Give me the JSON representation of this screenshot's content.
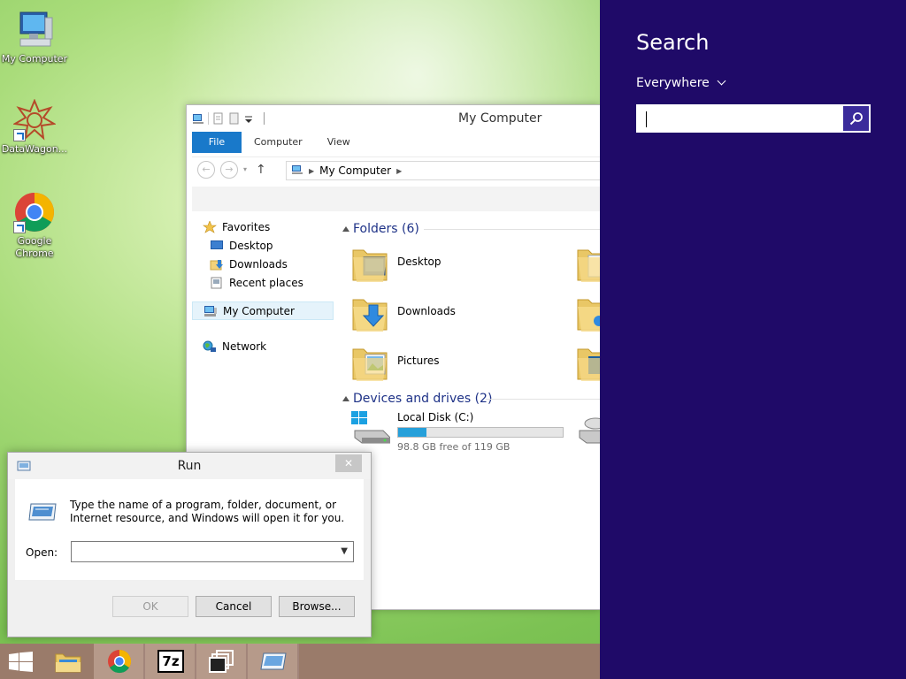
{
  "desktop": {
    "icons": [
      {
        "label": "My Computer"
      },
      {
        "label": "DataWagon..."
      },
      {
        "label": "Google Chrome"
      }
    ]
  },
  "explorer": {
    "title": "My Computer",
    "tabs": [
      "File",
      "Computer",
      "View"
    ],
    "address": "My Computer",
    "nav": {
      "favorites": "Favorites",
      "desktop": "Desktop",
      "downloads": "Downloads",
      "recent": "Recent places",
      "computer": "My Computer",
      "network": "Network"
    },
    "folders_header": "Folders (6)",
    "folders": [
      "Desktop",
      "Downloads",
      "Pictures"
    ],
    "drives_header": "Devices and drives (2)",
    "drive": {
      "name": "Local Disk (C:)",
      "free_text": "98.8 GB free of 119 GB",
      "used_fraction": 0.17
    }
  },
  "run": {
    "title": "Run",
    "close": "✕",
    "message": "Type the name of a program, folder, document, or Internet resource, and Windows will open it for you.",
    "open_label": "Open:",
    "open_value": "",
    "ok": "OK",
    "cancel": "Cancel",
    "browse": "Browse..."
  },
  "taskbar": {
    "items": [
      "start-icon",
      "file-explorer-icon",
      "chrome-icon",
      "7zip-icon",
      "task-view-icon",
      "run-icon"
    ],
    "sevenzip_text": "7z"
  },
  "charm": {
    "heading": "Search",
    "scope": "Everywhere",
    "query": "",
    "colors": {
      "background": "#1f0a68",
      "button": "#3a2b9b"
    }
  }
}
